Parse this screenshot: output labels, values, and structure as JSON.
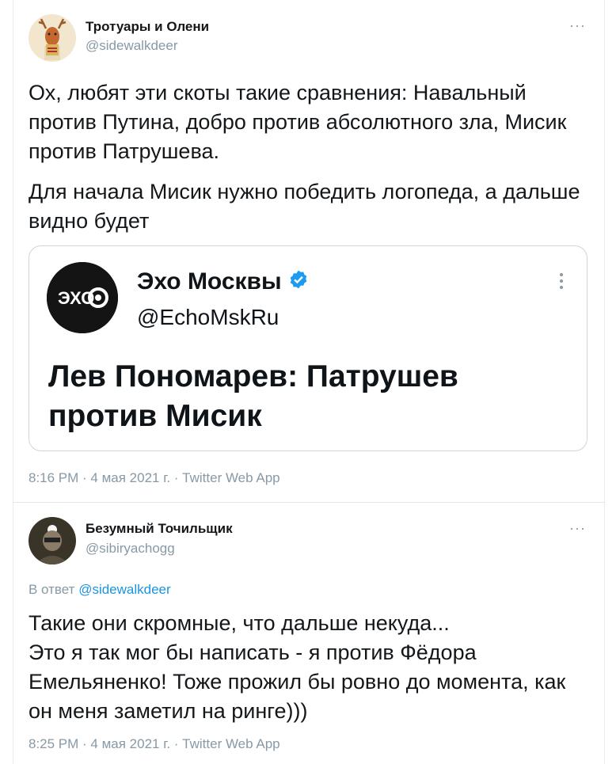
{
  "tweet1": {
    "name": "Тротуары и Олени",
    "handle": "@sidewalkdeer",
    "text_p1": "Ох, любят эти скоты такие сравнения: Навальный против Путина, добро против абсолютного зла, Мисик против Патрушева.",
    "text_p2": "Для начала Мисик нужно победить логопеда, а дальше видно будет",
    "timestamp": "8:16 PM · 4 мая 2021 г. · Twitter Web App",
    "more_label": "···",
    "avatar_icon": "deer-avatar",
    "quote": {
      "name": "Эхо Москвы",
      "handle": "@EchoMskRu",
      "text": "Лев Пономарев: Патрушев против Мисик",
      "logo_text": "ЭХО",
      "verified_color": "#1d9bf0"
    }
  },
  "tweet2": {
    "name": "Безумный Точильщик",
    "handle": "@sibiryachogg",
    "reply_prefix": "В ответ",
    "reply_mention": "@sidewalkdeer",
    "text": "Такие они скромные, что дальше некуда...\nЭто я так мог бы написать - я против Фёдора Емельяненко! Тоже прожил бы ровно до момента, как он меня заметил на ринге)))",
    "timestamp": "8:25 PM · 4 мая 2021 г. · Twitter Web App",
    "more_label": "···",
    "avatar_icon": "person-avatar"
  },
  "colors": {
    "secondary_text": "#8899a6",
    "link": "#1b95e0",
    "border": "#ccd6dd"
  }
}
